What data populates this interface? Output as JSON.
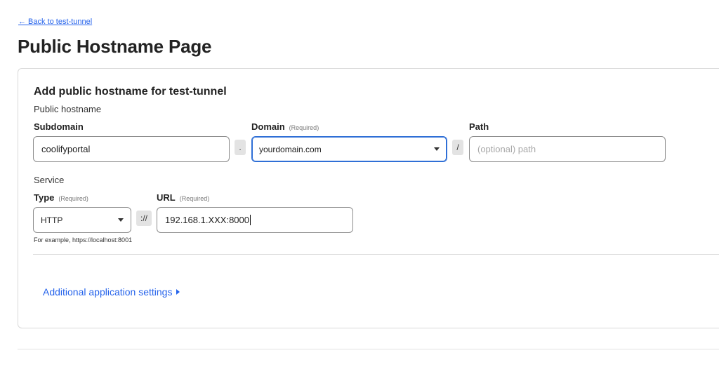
{
  "nav": {
    "back_label": "← Back to test-tunnel"
  },
  "page": {
    "title": "Public Hostname Page"
  },
  "form": {
    "heading": "Add public hostname for test-tunnel",
    "hostname_section": "Public hostname",
    "subdomain": {
      "label": "Subdomain",
      "value": "coolifyportal"
    },
    "dot_separator": ".",
    "domain": {
      "label": "Domain",
      "required": "(Required)",
      "value": "yourdomain.com"
    },
    "slash_separator": "/",
    "path": {
      "label": "Path",
      "placeholder": "(optional) path",
      "value": ""
    },
    "service_section": "Service",
    "type": {
      "label": "Type",
      "required": "(Required)",
      "value": "HTTP"
    },
    "scheme_separator": "://",
    "url": {
      "label": "URL",
      "required": "(Required)",
      "value": "192.168.1.XXX:8000"
    },
    "hint": "For example, https://localhost:8001",
    "additional_settings": "Additional application settings"
  },
  "colors": {
    "link": "#2563eb",
    "focus": "#2f6fd6",
    "border": "#8c8c8c"
  }
}
